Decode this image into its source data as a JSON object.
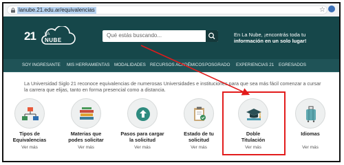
{
  "browser": {
    "url": "lanube.21.edu.ar/equivalencias",
    "icons": {
      "lock": "lock-icon",
      "star": "star-icon",
      "extension": "extension-icon"
    }
  },
  "header": {
    "logo_number": "21",
    "logo_la": "LA",
    "logo_nube": "NUBE",
    "search_placeholder": "Qué estás buscando...",
    "promo_line1": "En La Nube, ¡encontrás toda tu",
    "promo_line2": "información en un solo lugar!",
    "colors": {
      "header_bg": "#16474a",
      "nav_bg": "#1f5357",
      "highlight": "#e21b1b"
    }
  },
  "nav": {
    "items": [
      "SOY INGRESANTE",
      "MIS HERRAMIENTAS",
      "MODALIDADES",
      "RECURSOS ACADÉMICOS",
      "POSGRADO",
      "EXPERIENCIAS 21",
      "EGRESADOS"
    ]
  },
  "intro": {
    "line1": "La Universidad Siglo 21 reconoce equivalencias de numerosas Universidades e instituciones para que sea más fácil comenzar a cursar",
    "line2": "la carrera que elijas, tanto en forma presencial como a distancia."
  },
  "cards": [
    {
      "title_line1": "Tipos de",
      "title_line2": "Equivalencias",
      "more": "Ver más",
      "icon": "diagram-icon"
    },
    {
      "title_line1": "Materias que",
      "title_line2": "podes solicitar",
      "more": "Ver más",
      "icon": "books-icon"
    },
    {
      "title_line1": "Pasos para cargar",
      "title_line2": "la solicitud",
      "more": "Ver más",
      "icon": "upload-icon"
    },
    {
      "title_line1": "Estado de tu",
      "title_line2": "solicitud",
      "more": "Ver más",
      "icon": "clipboard-icon"
    },
    {
      "title_line1": "Doble",
      "title_line2": "Titulación",
      "more": "Ver más",
      "icon": "graduation-cap-icon"
    },
    {
      "title_line1": "Idiomas",
      "title_line2": "",
      "more": "Ver más",
      "icon": "suitcase-icon"
    }
  ]
}
